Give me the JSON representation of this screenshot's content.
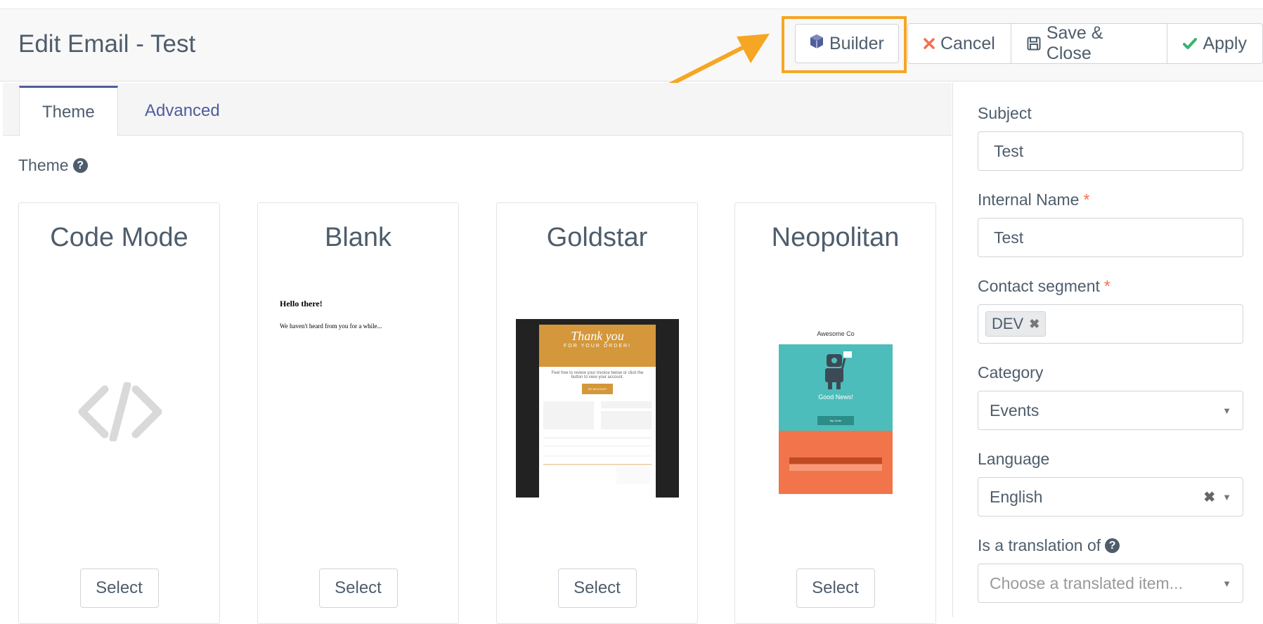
{
  "header": {
    "title": "Edit Email - Test",
    "buttons": {
      "builder": "Builder",
      "cancel": "Cancel",
      "save_close": "Save & Close",
      "apply": "Apply"
    }
  },
  "tabs": [
    {
      "label": "Theme",
      "active": true
    },
    {
      "label": "Advanced",
      "active": false
    }
  ],
  "theme_section": {
    "label": "Theme",
    "cards": [
      {
        "name": "Code Mode",
        "select": "Select"
      },
      {
        "name": "Blank",
        "select": "Select",
        "preview": {
          "heading": "Hello there!",
          "body": "We haven't heard from you for a while..."
        }
      },
      {
        "name": "Goldstar",
        "select": "Select",
        "preview": {
          "heading": "Thank you",
          "subheading": "FOR YOUR ORDER!",
          "body": "Feel free to review your invoice below or click the button to view your account.",
          "button": "MY ACCOUNT"
        }
      },
      {
        "name": "Neopolitan",
        "select": "Select",
        "preview": {
          "brand": "Awesome Co",
          "heading": "Good News!",
          "button": "My Order"
        }
      }
    ]
  },
  "form": {
    "subject": {
      "label": "Subject",
      "value": "Test"
    },
    "internal_name": {
      "label": "Internal Name",
      "required": "*",
      "value": "Test"
    },
    "contact_segment": {
      "label": "Contact segment",
      "required": "*",
      "chip": "DEV"
    },
    "category": {
      "label": "Category",
      "value": "Events"
    },
    "language": {
      "label": "Language",
      "value": "English"
    },
    "translation": {
      "label": "Is a translation of",
      "placeholder": "Choose a translated item..."
    }
  },
  "colors": {
    "accent_highlight": "#f5a623",
    "tab_active_border": "#4e5d9d",
    "cancel_icon": "#f2704f",
    "apply_icon": "#35b56d",
    "required": "#f2704f"
  }
}
